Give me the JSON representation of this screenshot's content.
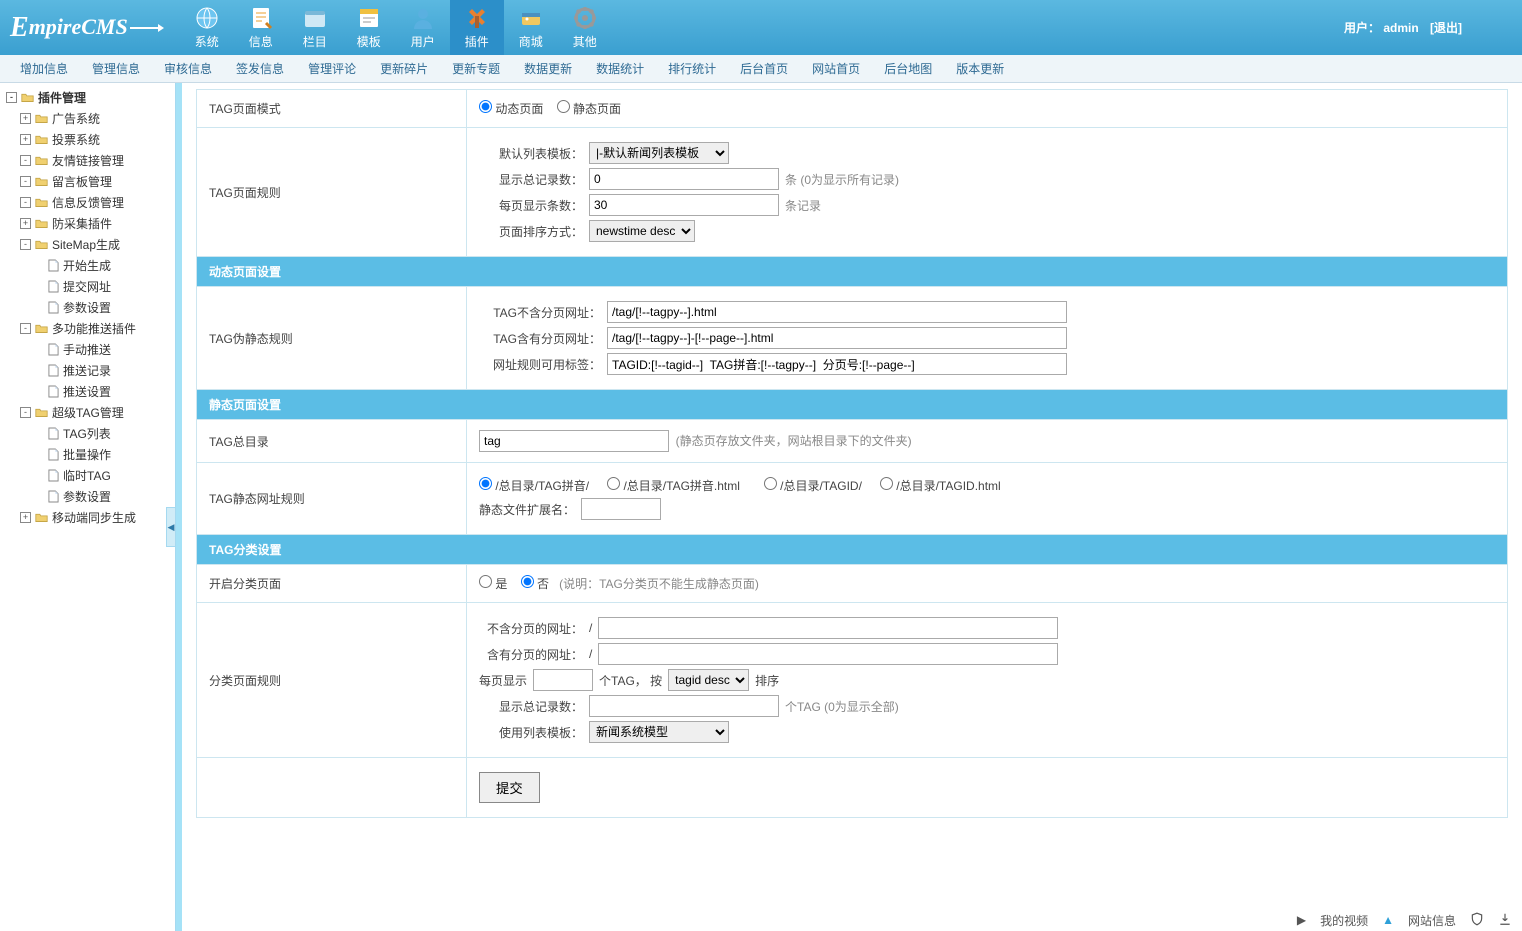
{
  "logo": "mpireCMS",
  "user": {
    "prefix": "用户：",
    "name": "admin",
    "logout": "[退出]"
  },
  "topnav": [
    {
      "key": "system",
      "label": "系统"
    },
    {
      "key": "info",
      "label": "信息"
    },
    {
      "key": "column",
      "label": "栏目"
    },
    {
      "key": "template",
      "label": "模板"
    },
    {
      "key": "user",
      "label": "用户"
    },
    {
      "key": "plugin",
      "label": "插件",
      "active": true
    },
    {
      "key": "shop",
      "label": "商城"
    },
    {
      "key": "other",
      "label": "其他"
    }
  ],
  "subnav": [
    "增加信息",
    "管理信息",
    "审核信息",
    "签发信息",
    "管理评论",
    "更新碎片",
    "更新专题",
    "数据更新",
    "数据统计",
    "排行统计",
    "后台首页",
    "网站首页",
    "后台地图",
    "版本更新"
  ],
  "tree": {
    "root": "插件管理",
    "items": [
      {
        "label": "广告系统",
        "exp": "+"
      },
      {
        "label": "投票系统",
        "exp": "+"
      },
      {
        "label": "友情链接管理",
        "exp": "-"
      },
      {
        "label": "留言板管理",
        "exp": "-"
      },
      {
        "label": "信息反馈管理",
        "exp": "-"
      },
      {
        "label": "防采集插件",
        "exp": "+"
      },
      {
        "label": "SiteMap生成",
        "exp": "-",
        "children": [
          "开始生成",
          "提交网址",
          "参数设置"
        ]
      },
      {
        "label": "多功能推送插件",
        "exp": "-",
        "children": [
          "手动推送",
          "推送记录",
          "推送设置"
        ]
      },
      {
        "label": "超级TAG管理",
        "exp": "-",
        "children": [
          "TAG列表",
          "批量操作",
          "临时TAG",
          "参数设置"
        ]
      },
      {
        "label": "移动端同步生成",
        "exp": "+"
      }
    ]
  },
  "form": {
    "row_mode": {
      "label": "TAG页面模式",
      "opt1": "动态页面",
      "opt2": "静态页面"
    },
    "row_rule": {
      "label": "TAG页面规则",
      "tpl_label": "默认列表模板：",
      "tpl_value": "|-默认新闻列表模板",
      "total_label": "显示总记录数：",
      "total_value": "0",
      "total_hint": "条 (0为显示所有记录)",
      "per_label": "每页显示条数：",
      "per_value": "30",
      "per_hint": "条记录",
      "order_label": "页面排序方式：",
      "order_value": "newstime desc"
    },
    "sec_dyn": "动态页面设置",
    "row_pseudo": {
      "label": "TAG伪静态规则",
      "u1_label": "TAG不含分页网址：",
      "u1_value": "/tag/[!--tagpy--].html",
      "u2_label": "TAG含有分页网址：",
      "u2_value": "/tag/[!--tagpy--]-[!--page--].html",
      "u3_label": "网址规则可用标签：",
      "u3_value": "TAGID:[!--tagid--]  TAG拼音:[!--tagpy--]  分页号:[!--page--]"
    },
    "sec_static": "静态页面设置",
    "row_dir": {
      "label": "TAG总目录",
      "value": "tag",
      "hint": "(静态页存放文件夹，网站根目录下的文件夹)"
    },
    "row_surl": {
      "label": "TAG静态网址规则",
      "opt1": "/总目录/TAG拼音/",
      "opt2": "/总目录/TAG拼音.html",
      "opt3": "/总目录/TAGID/",
      "opt4": "/总目录/TAGID.html",
      "ext_label": "静态文件扩展名："
    },
    "sec_cat": "TAG分类设置",
    "row_catopen": {
      "label": "开启分类页面",
      "yes": "是",
      "no": "否",
      "hint": "(说明：TAG分类页不能生成静态页面)"
    },
    "row_catrule": {
      "label": "分类页面规则",
      "u1_label": "不含分页的网址：",
      "u1_prefix": "/",
      "u2_label": "含有分页的网址：",
      "u2_prefix": "/",
      "per_label": "每页显示",
      "per_mid": "个TAG， 按",
      "per_order": "tagid desc",
      "per_suffix": "排序",
      "total_label": "显示总记录数：",
      "total_hint": "个TAG (0为显示全部)",
      "tpl_label": "使用列表模板：",
      "tpl_value": "新闻系统模型"
    },
    "submit": "提交"
  },
  "status": {
    "video": "我的视频",
    "info": "网站信息"
  }
}
